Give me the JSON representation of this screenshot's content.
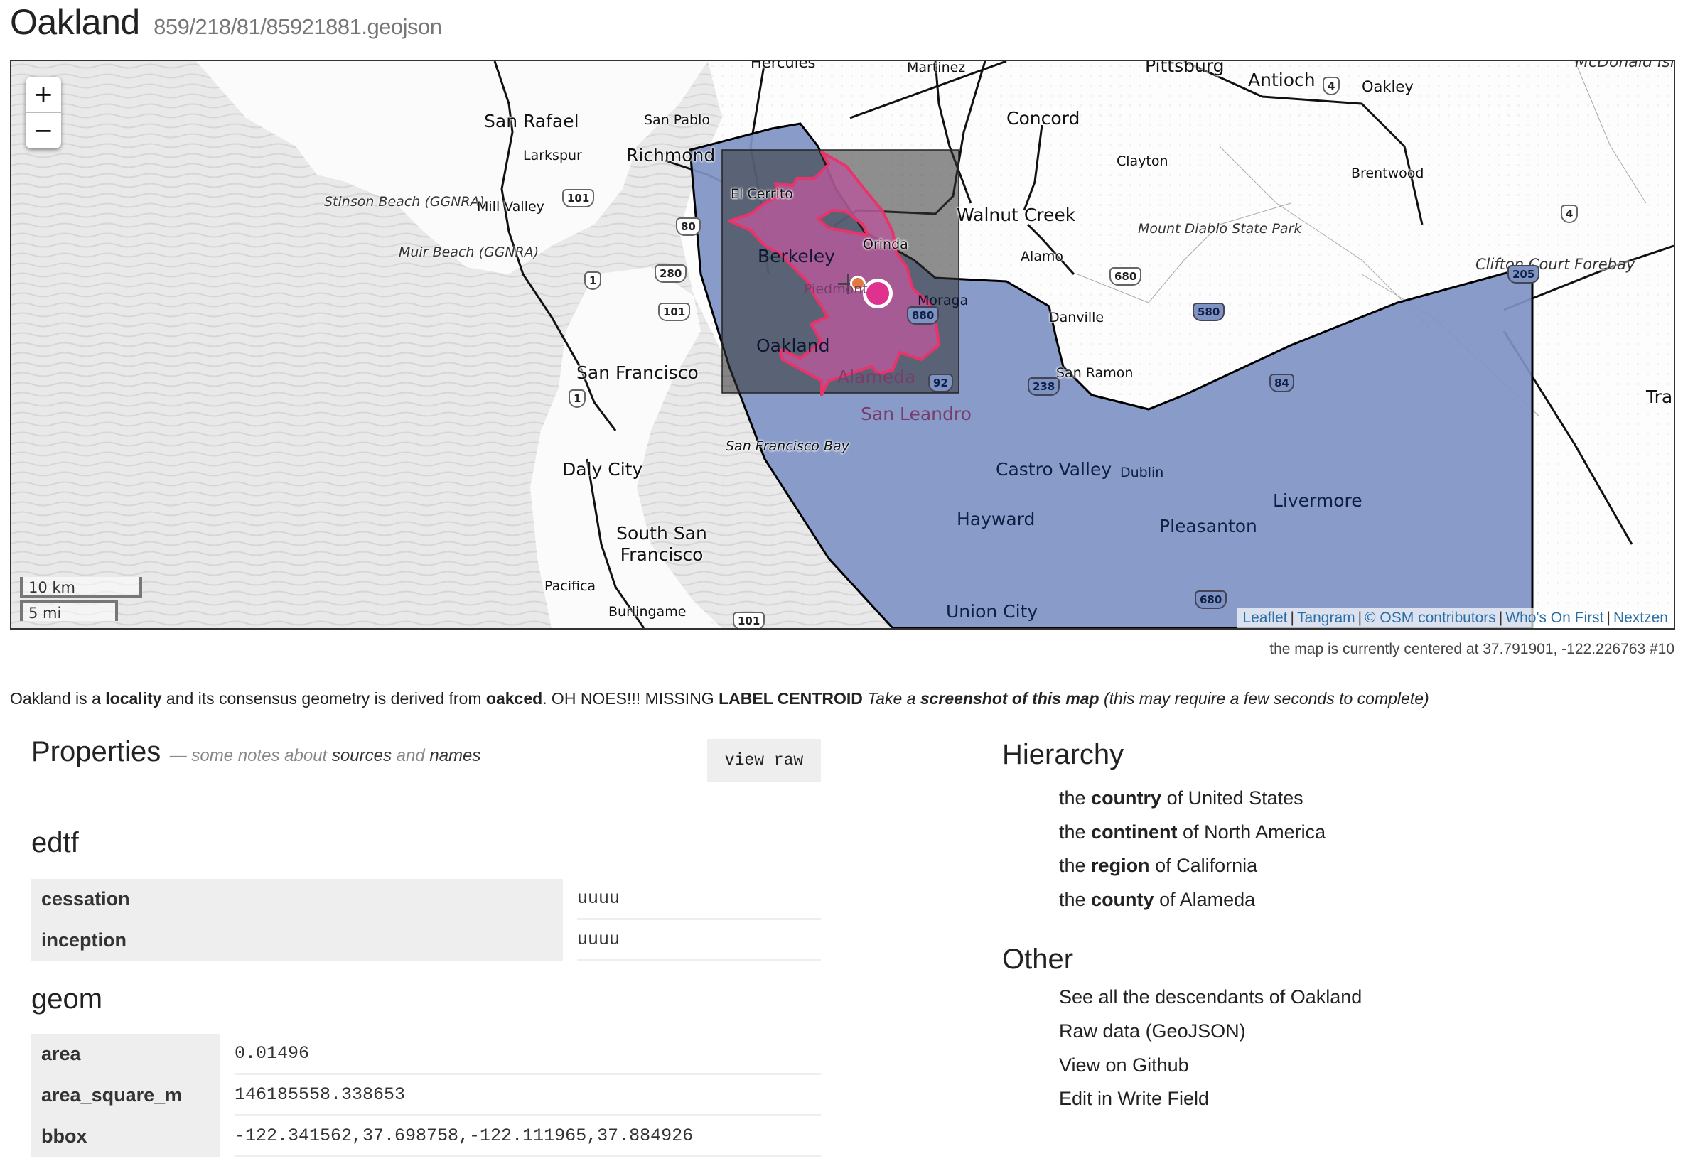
{
  "header": {
    "title": "Oakland",
    "path": "859/218/81/85921881.geojson"
  },
  "map": {
    "zoom_in": "+",
    "zoom_out": "−",
    "scale_km": "10 km",
    "scale_mi": "5 mi",
    "attribution": [
      "Leaflet",
      "Tangram",
      "© OSM contributors",
      "Who's On First",
      "Nextzen"
    ],
    "colors": {
      "water": "#e6e6e6",
      "land": "#ffffff",
      "parent_fill": "#7f93c3",
      "bbox_fill": "#333333",
      "locality_fill": "#b55a9a",
      "locality_stroke": "#e8336b",
      "centroid": "#e0318f",
      "secondary_centroid": "#e07840"
    },
    "labels": {
      "hercules": "Hercules",
      "martinez": "Martinez",
      "pittsburg": "Pittsburg",
      "antioch": "Antioch",
      "oakley": "Oakley",
      "mcdonald": "McDonald Island",
      "san_rafael": "San Rafael",
      "san_pablo": "San Pablo",
      "larkspur": "Larkspur",
      "richmond": "Richmond",
      "concord": "Concord",
      "clayton": "Clayton",
      "brentwood": "Brentwood",
      "stinson": "Stinson Beach (GGNRA)",
      "mill_valley": "Mill Valley",
      "el_cerrito": "El Cerrito",
      "walnut_creek": "Walnut Creek",
      "muir": "Muir Beach (GGNRA)",
      "berkeley": "Berkeley",
      "orinda": "Orinda",
      "alamo": "Alamo",
      "mount_diablo": "Mount Diablo State Park",
      "clifton": "Clifton Court Forebay",
      "piedmont": "Piedmont",
      "moraga": "Moraga",
      "danville": "Danville",
      "oakland": "Oakland",
      "san_francisco": "San Francisco",
      "alameda": "Alameda",
      "san_ramon": "San Ramon",
      "san_leandro": "San Leandro",
      "tracy": "Tra",
      "sf_bay": "San Francisco Bay",
      "daly_city": "Daly City",
      "castro_valley": "Castro Valley",
      "dublin": "Dublin",
      "livermore": "Livermore",
      "hayward": "Hayward",
      "pleasanton": "Pleasanton",
      "south_sf": "South San Francisco",
      "pacifica": "Pacifica",
      "burlingame": "Burlingame",
      "union_city": "Union City"
    },
    "shields": {
      "us101a": "101",
      "i80": "80",
      "i280": "280",
      "ca1a": "1",
      "us101b": "101",
      "ca1b": "1",
      "i680a": "680",
      "i205": "205",
      "i580": "580",
      "i880": "880",
      "ca92": "92",
      "ca238": "238",
      "ca84": "84",
      "i680b": "680",
      "ca4a": "4",
      "ca4b": "4",
      "us101c": "101"
    }
  },
  "center_info": "the map is currently centered at 37.791901, -122.226763 #10",
  "description": {
    "p1": "Oakland is a ",
    "placetype": "locality",
    "p2": " and its consensus geometry is derived from ",
    "source": "oakced",
    "p3": ". OH NOES!!! MISSING ",
    "missing": "LABEL CENTROID",
    "p4": " Take a ",
    "screenshot": "screenshot of this map",
    "p5": " (this may require a few seconds to complete)"
  },
  "properties": {
    "title": "Properties",
    "notes_pre": "— some notes about ",
    "notes_sources": "sources",
    "notes_and": " and ",
    "notes_names": "names",
    "view_raw": "view raw",
    "sections": [
      {
        "name": "edtf",
        "rows": [
          {
            "key": "cessation",
            "value": "uuuu"
          },
          {
            "key": "inception",
            "value": "uuuu"
          }
        ]
      },
      {
        "name": "geom",
        "rows": [
          {
            "key": "area",
            "value": "0.01496"
          },
          {
            "key": "area_square_m",
            "value": "146185558.338653"
          },
          {
            "key": "bbox",
            "value": "-122.341562,37.698758,-122.111965,37.884926"
          }
        ]
      }
    ]
  },
  "hierarchy": {
    "title": "Hierarchy",
    "items": [
      {
        "pre": "the ",
        "type": "country",
        "mid": " of ",
        "name": "United States"
      },
      {
        "pre": "the ",
        "type": "continent",
        "mid": " of ",
        "name": "North America"
      },
      {
        "pre": "the ",
        "type": "region",
        "mid": " of ",
        "name": "California"
      },
      {
        "pre": "the ",
        "type": "county",
        "mid": " of ",
        "name": "Alameda"
      }
    ]
  },
  "other": {
    "title": "Other",
    "links": [
      "See all the descendants of Oakland",
      "Raw data (GeoJSON)",
      "View on Github",
      "Edit in Write Field"
    ]
  }
}
